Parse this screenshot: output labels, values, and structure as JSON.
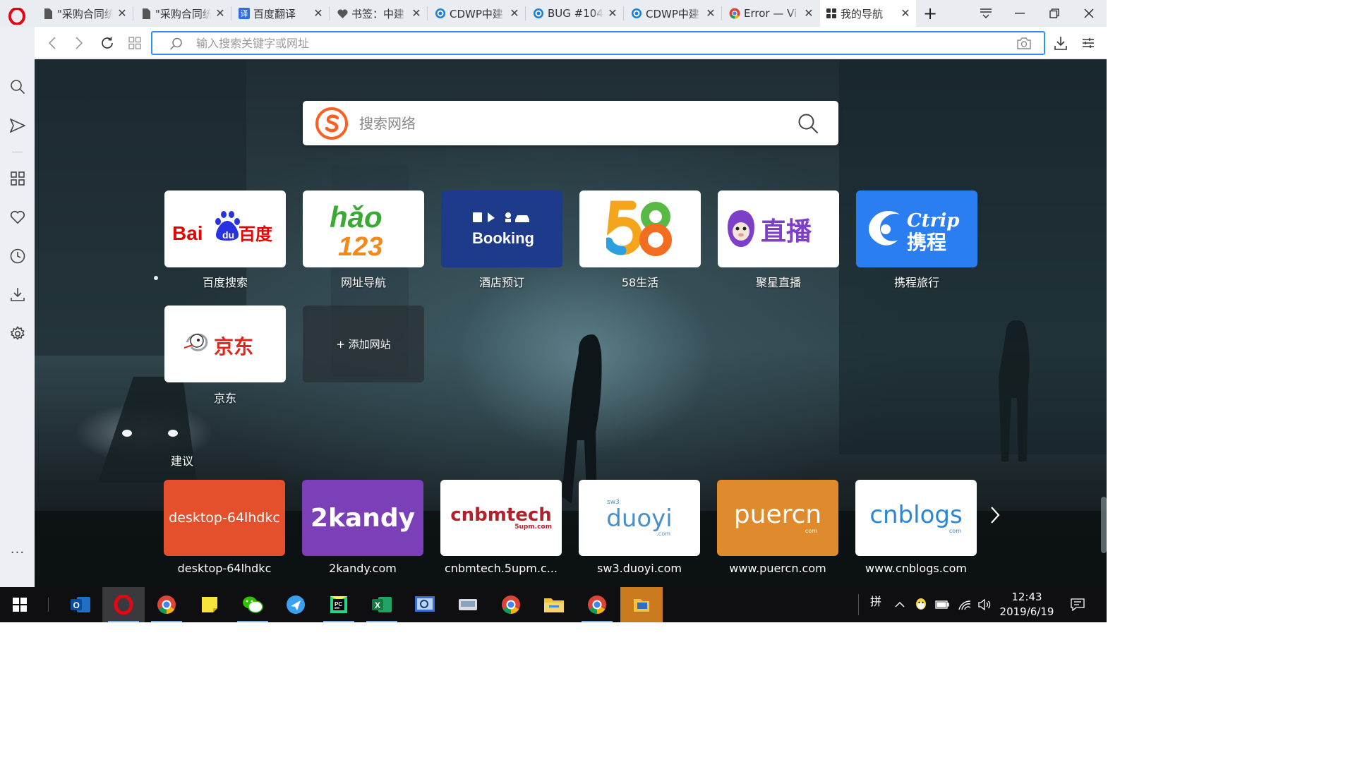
{
  "tabs": [
    {
      "title": "\"采购合同统",
      "icon": "document-icon"
    },
    {
      "title": "\"采购合同统",
      "icon": "document-icon"
    },
    {
      "title": "百度翻译",
      "icon": "translate-icon",
      "icon_text": "译"
    },
    {
      "title": "书签：中建",
      "icon": "heart-icon"
    },
    {
      "title": "CDWP中建",
      "icon": "cdwp-icon"
    },
    {
      "title": "BUG #104",
      "icon": "cdwp-icon"
    },
    {
      "title": "CDWP中建",
      "icon": "cdwp-icon"
    },
    {
      "title": "Error — Vi",
      "icon": "chrome-icon"
    },
    {
      "title": "我的导航",
      "icon": "grid-icon",
      "active": true
    }
  ],
  "address_bar": {
    "placeholder": "输入搜索关键字或网址",
    "value": ""
  },
  "search": {
    "placeholder": "搜索网络"
  },
  "speed_dial": [
    {
      "label": "百度搜索",
      "logo_text": "Bai百度",
      "bg": "#ffffff"
    },
    {
      "label": "网址导航",
      "logo_text": "hǎo 123",
      "bg": "#ffffff"
    },
    {
      "label": "酒店预订",
      "logo_text": "Booking",
      "bg": "#1e3a8a"
    },
    {
      "label": "58生活",
      "logo_text": "58",
      "bg": "#ffffff"
    },
    {
      "label": "聚星直播",
      "logo_text": "直播",
      "bg": "#ffffff"
    },
    {
      "label": "携程旅行",
      "logo_text_top": "Ctrip",
      "logo_text_bottom": "携程",
      "bg": "#2b7ef0"
    },
    {
      "label": "京东",
      "logo_text": "京东",
      "bg": "#ffffff"
    }
  ],
  "add_site": {
    "label": "+ 添加网站"
  },
  "suggestions_title": "建议",
  "suggestions": [
    {
      "tile_text": "desktop-64lhdkc",
      "label": "desktop-64lhdkc",
      "bg": "#e4502c",
      "fg": "#ffffff"
    },
    {
      "tile_text": "2kandy",
      "label": "2kandy.com",
      "bg": "#7b3fb8",
      "fg": "#ffffff"
    },
    {
      "tile_text": "cnbmtech",
      "sub": "5upm.com",
      "label": "cnbmtech.5upm.c...",
      "bg": "#ffffff",
      "fg": "#b3202a"
    },
    {
      "tile_text": "duoyi",
      "sub": ".com",
      "pre": "sw3",
      "label": "sw3.duoyi.com",
      "bg": "#ffffff",
      "fg": "#4a90c8"
    },
    {
      "tile_text": "puercn",
      "sub": "com",
      "label": "www.puercn.com",
      "bg": "#e08a2e",
      "fg": "#ffffff"
    },
    {
      "tile_text": "cnblogs",
      "sub": "com",
      "label": "www.cnblogs.com",
      "bg": "#ffffff",
      "fg": "#2a86d6"
    }
  ],
  "taskbar": {
    "time": "12:43",
    "date": "2019/6/19",
    "ime": "拼",
    "apps": [
      "outlook-icon",
      "opera-icon",
      "chrome-icon",
      "sticky-notes-icon",
      "wechat-icon",
      "feishu-icon",
      "pycharm-icon",
      "excel-icon",
      "image-viewer-icon",
      "scanner-icon",
      "chrome-icon",
      "file-explorer-icon",
      "chrome-icon",
      "pinned-app-icon"
    ]
  },
  "colors": {
    "accent": "#2d8ef4",
    "opera_red": "#e30613"
  }
}
